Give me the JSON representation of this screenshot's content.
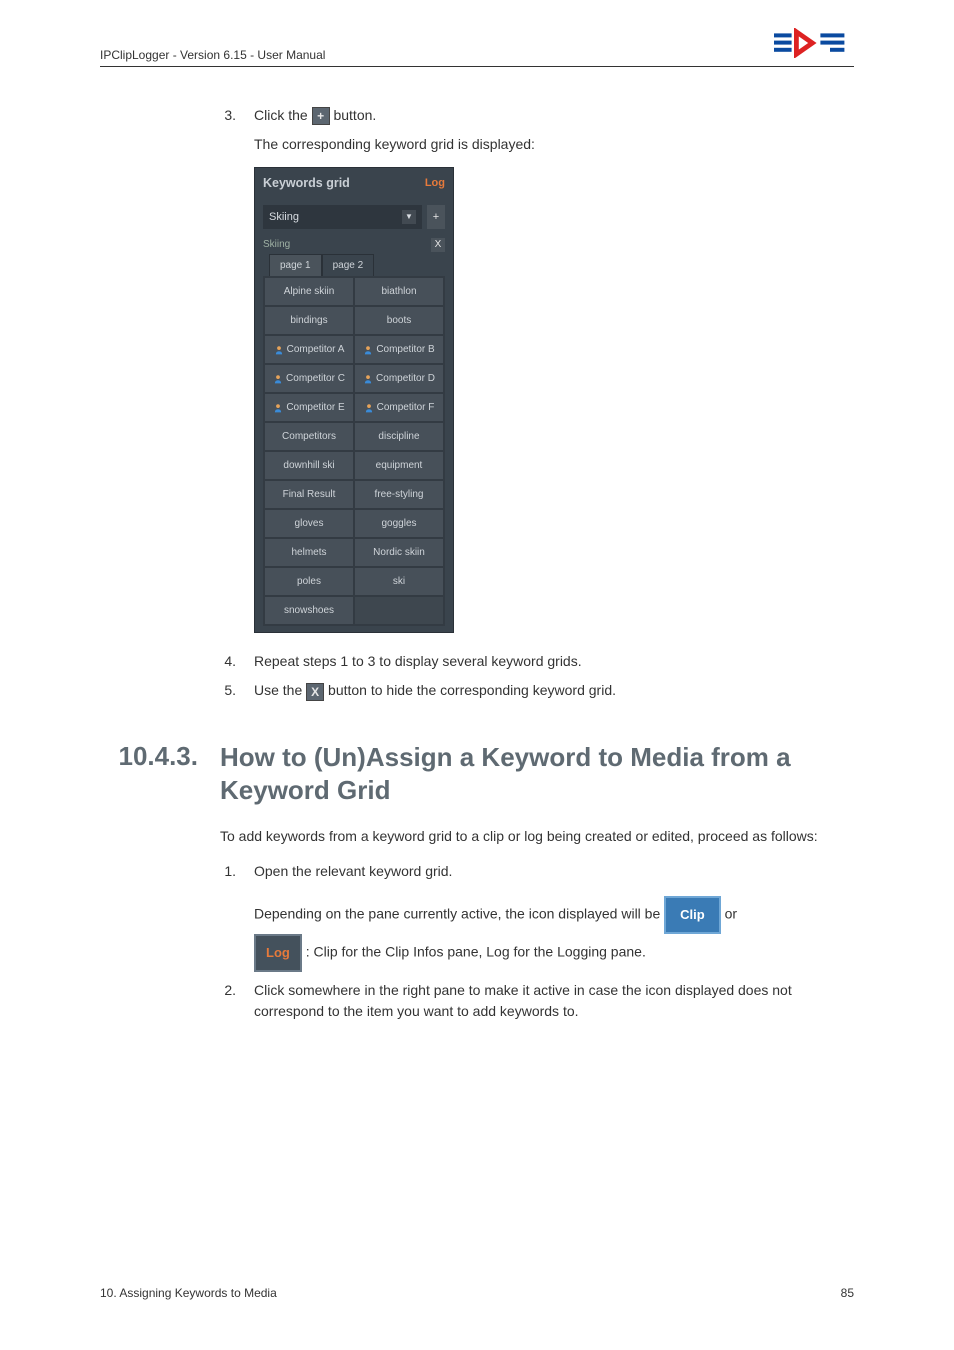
{
  "header": {
    "doc_title": "IPClipLogger - Version 6.15 - User Manual"
  },
  "step3": {
    "num": "3.",
    "text_before": "Click the ",
    "icon_label": "+",
    "text_after": " button.",
    "sub": "The corresponding keyword grid is displayed:"
  },
  "kg": {
    "title": "Keywords grid",
    "log_label": "Log",
    "select_value": "Skiing",
    "add_label": "+",
    "grid_name": "Skiing",
    "close_label": "X",
    "tabs": [
      "page 1",
      "page 2"
    ],
    "rows": [
      [
        {
          "t": "Alpine skiin",
          "p": false
        },
        {
          "t": "biathlon",
          "p": false
        }
      ],
      [
        {
          "t": "bindings",
          "p": false
        },
        {
          "t": "boots",
          "p": false
        }
      ],
      [
        {
          "t": "Competitor A",
          "p": true
        },
        {
          "t": "Competitor B",
          "p": true
        }
      ],
      [
        {
          "t": "Competitor C",
          "p": true
        },
        {
          "t": "Competitor D",
          "p": true
        }
      ],
      [
        {
          "t": "Competitor E",
          "p": true
        },
        {
          "t": "Competitor F",
          "p": true
        }
      ],
      [
        {
          "t": "Competitors",
          "p": false
        },
        {
          "t": "discipline",
          "p": false
        }
      ],
      [
        {
          "t": "downhill ski",
          "p": false
        },
        {
          "t": "equipment",
          "p": false
        }
      ],
      [
        {
          "t": "Final Result",
          "p": false
        },
        {
          "t": "free-styling",
          "p": false
        }
      ],
      [
        {
          "t": "gloves",
          "p": false
        },
        {
          "t": "goggles",
          "p": false
        }
      ],
      [
        {
          "t": "helmets",
          "p": false
        },
        {
          "t": "Nordic skiin",
          "p": false
        }
      ],
      [
        {
          "t": "poles",
          "p": false
        },
        {
          "t": "ski",
          "p": false
        }
      ],
      [
        {
          "t": "snowshoes",
          "p": false
        },
        {
          "t": "",
          "p": false
        }
      ]
    ]
  },
  "step4": {
    "num": "4.",
    "text": "Repeat steps 1 to 3 to display several keyword grids."
  },
  "step5": {
    "num": "5.",
    "text_before": "Use the ",
    "icon_label": "X",
    "text_after": " button to hide the corresponding keyword grid."
  },
  "section": {
    "num": "10.4.3.",
    "title": "How to (Un)Assign a Keyword to Media from a Keyword Grid"
  },
  "intro": "To add keywords from a keyword grid to a clip or log being created or edited, proceed as follows:",
  "stepA": {
    "num": "1.",
    "text": "Open the relevant keyword grid.",
    "depending_before": "Depending on the pane currently active, the icon displayed will be ",
    "clip_label": "Clip",
    "depending_mid": " or ",
    "log_label": "Log",
    "depending_after": ": Clip for the Clip Infos pane, Log for the Logging pane."
  },
  "stepB": {
    "num": "2.",
    "text": "Click somewhere in the right pane to make it active in case the icon displayed does not correspond to the item you want to add keywords to."
  },
  "footer": {
    "left": "10. Assigning Keywords to Media",
    "right": "85"
  }
}
